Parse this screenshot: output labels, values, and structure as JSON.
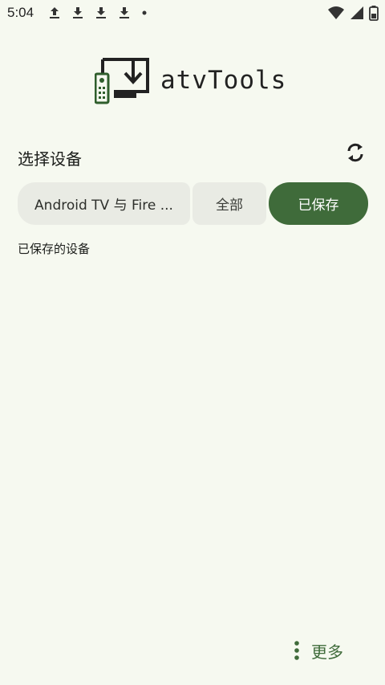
{
  "status_bar": {
    "time": "5:04",
    "icons_left": [
      "upload-icon",
      "download-icon",
      "download-icon",
      "download-icon",
      "dot-icon"
    ],
    "icons_right": [
      "wifi-icon",
      "signal-icon",
      "battery-icon"
    ]
  },
  "app": {
    "name": "atvTools",
    "logo_icon": "tv-download-remote-icon"
  },
  "device_selection": {
    "title": "选择设备",
    "refresh_icon": "refresh-icon",
    "tabs": [
      {
        "label": "Android TV 与 Fire ...",
        "selected": false
      },
      {
        "label": "全部",
        "selected": false
      },
      {
        "label": "已保存",
        "selected": true
      }
    ],
    "list_heading": "已保存的设备"
  },
  "more_button": {
    "label": "更多",
    "icon": "more-vert-icon"
  },
  "colors": {
    "background": "#f6f9f0",
    "accent": "#3f6b3a",
    "tab_inactive": "#e9ebe4"
  }
}
